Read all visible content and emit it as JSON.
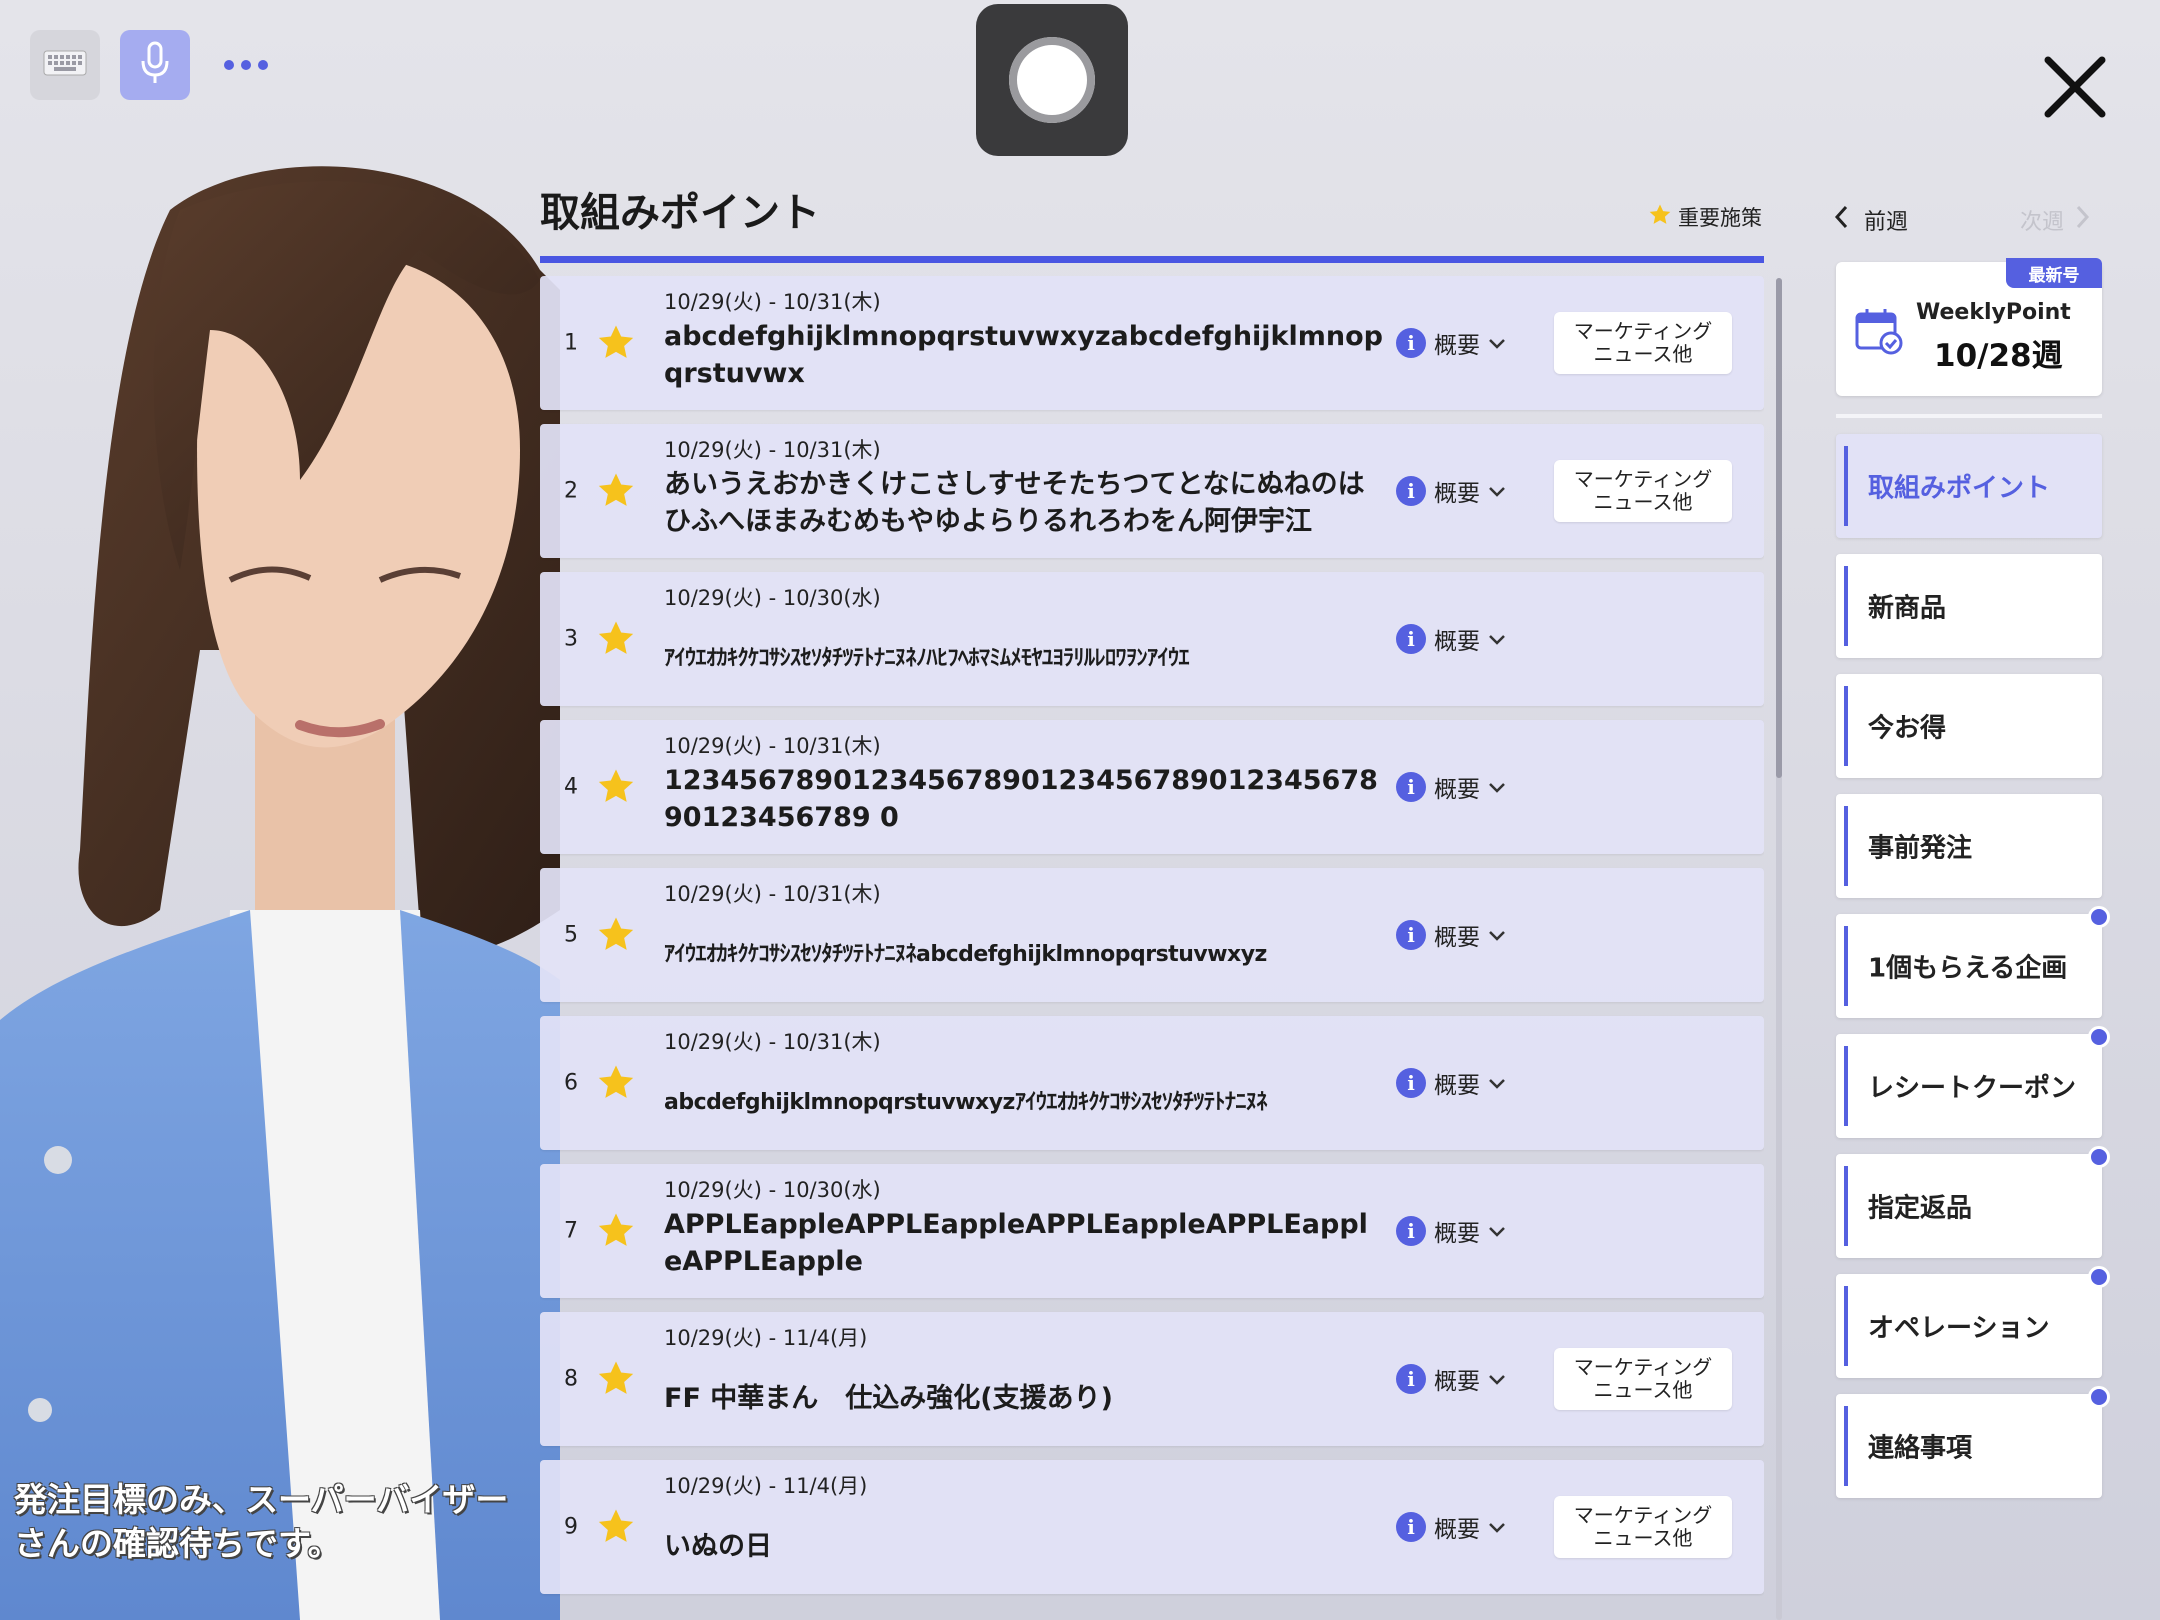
{
  "toolbar": {
    "keyboard_icon": "keyboard-icon",
    "mic_icon": "microphone-icon",
    "more_icon": "more-dots-icon",
    "record_icon": "record-icon",
    "close_icon": "close-icon"
  },
  "avatar": {
    "caption": "発注目標のみ、スーパーバイザーさんの確認待ちです。"
  },
  "list": {
    "title": "取組みポイント",
    "legend_label": "重要施策",
    "summary_label": "概要",
    "items": [
      {
        "no": "1",
        "date": "10/29(火) - 10/31(木)",
        "title": "abcdefghijklmnopqrstuvwxyzabcdefghijklmnopqrstuvwx",
        "tag": "マーケティング\nニュース他",
        "important": true
      },
      {
        "no": "2",
        "date": "10/29(火) - 10/31(木)",
        "title": "あいうえおかきくけこさしすせそたちつてとなにぬねのはひふへほまみむめもやゆよらりるれろわをん阿伊宇江",
        "tag": "マーケティング\nニュース他",
        "important": true
      },
      {
        "no": "3",
        "date": "10/29(火) - 10/30(水)",
        "title": "ｱｲｳｴｵｶｷｸｹｺｻｼｽｾｿﾀﾁﾂﾃﾄﾅﾆﾇﾈﾉﾊﾋﾌﾍﾎﾏﾐﾑﾒﾓﾔﾕﾖﾗﾘﾙﾚﾛﾜｦﾝｱｲｳｴ",
        "tag": "",
        "important": true
      },
      {
        "no": "4",
        "date": "10/29(火) - 10/31(木)",
        "title": "1234567890123456789012345678901234567890123456789 0",
        "tag": "",
        "important": true
      },
      {
        "no": "5",
        "date": "10/29(火) - 10/31(木)",
        "title": "ｱｲｳｴｵｶｷｸｹｺｻｼｽｾｿﾀﾁﾂﾃﾄﾅﾆﾇﾈabcdefghijklmnopqrstuvwxyz",
        "tag": "",
        "important": true
      },
      {
        "no": "6",
        "date": "10/29(火) - 10/31(木)",
        "title": "abcdefghijklmnopqrstuvwxyzｱｲｳｴｵｶｷｸｹｺｻｼｽｾｿﾀﾁﾂﾃﾄﾅﾆﾇﾈ",
        "tag": "",
        "important": true
      },
      {
        "no": "7",
        "date": "10/29(火) - 10/30(水)",
        "title": "APPLEappleAPPLEappleAPPLEappleAPPLEappleAPPLEapple",
        "tag": "",
        "important": true
      },
      {
        "no": "8",
        "date": "10/29(火) - 11/4(月)",
        "title": "FF 中華まん　仕込み強化(支援あり)",
        "tag": "マーケティング\nニュース他",
        "important": true
      },
      {
        "no": "9",
        "date": "10/29(火) - 11/4(月)",
        "title": "いぬの日",
        "tag": "マーケティング\nニュース他",
        "important": true
      }
    ]
  },
  "sidebar": {
    "prev_week": "前週",
    "next_week": "次週",
    "weekly": {
      "badge": "最新号",
      "label": "WeeklyPoint",
      "week": "10/28週"
    },
    "nav": [
      {
        "label": "取組みポイント",
        "active": true,
        "dot": false
      },
      {
        "label": "新商品",
        "active": false,
        "dot": false
      },
      {
        "label": "今お得",
        "active": false,
        "dot": false
      },
      {
        "label": "事前発注",
        "active": false,
        "dot": false
      },
      {
        "label": "1個もらえる企画",
        "active": false,
        "dot": true
      },
      {
        "label": "レシートクーポン",
        "active": false,
        "dot": true
      },
      {
        "label": "指定返品",
        "active": false,
        "dot": true
      },
      {
        "label": "オペレーション",
        "active": false,
        "dot": true
      },
      {
        "label": "連絡事項",
        "active": false,
        "dot": true
      }
    ]
  },
  "colors": {
    "accent": "#5560e0",
    "star": "#f6c21c",
    "row_bg": "#e2e2f6"
  }
}
